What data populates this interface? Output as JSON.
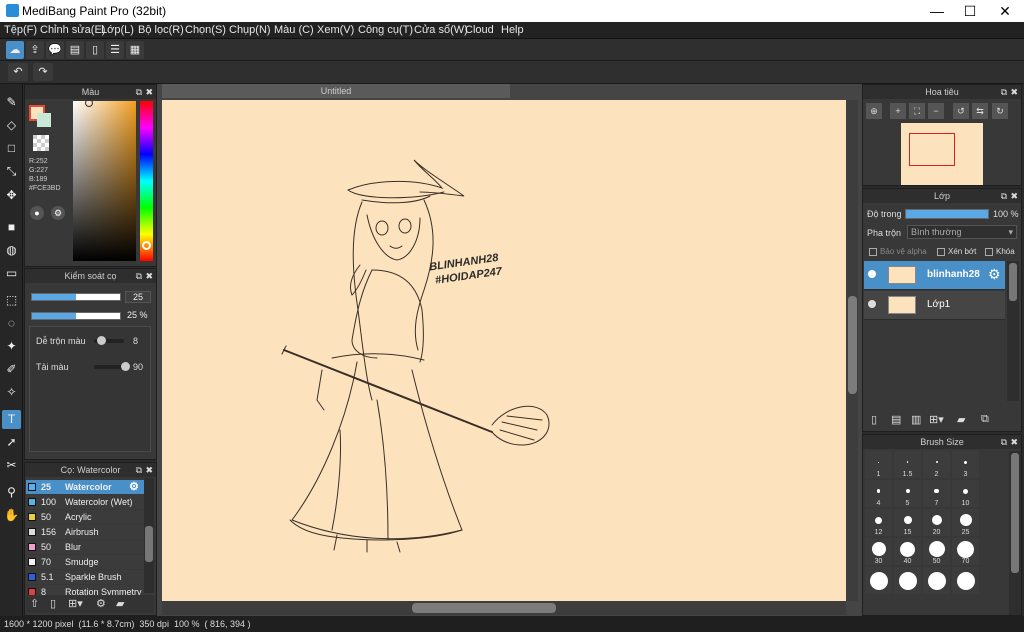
{
  "window": {
    "title": "MediBang Paint Pro (32bit)",
    "minimize": "—",
    "maximize": "☐",
    "close": "✕"
  },
  "menu": [
    "Tệp(F)",
    "Chỉnh sửa(E)",
    "Lớp(L)",
    "Bộ lọc(R)",
    "Chọn(S)",
    "Chụp(N)",
    "Màu (C)",
    "Xem(V)",
    "Công cụ(T)",
    "Cửa sổ(W)",
    "Cloud",
    "Help"
  ],
  "canvas": {
    "tab": "Untitled",
    "paper_color": "#FCE3BD",
    "watermark_line1": "BLINHANH28",
    "watermark_line2": "#HOIDAP247"
  },
  "color_panel": {
    "title": "Màu",
    "r": "R:252",
    "g": "G:227",
    "b": "B:189",
    "hex": "#FCE3BD"
  },
  "brush_control": {
    "title": "Kiểm soát cọ",
    "size_value": "25",
    "opacity_value": "25 %",
    "opacity_fraction": 0.5,
    "size_fraction": 0.5,
    "blend_label": "Dễ trộn màu",
    "blend_value": "8",
    "blend_fraction": 0.1,
    "reload_label": "Tải màu",
    "reload_value": "90",
    "reload_fraction": 0.9
  },
  "brush_list": {
    "title": "Cọ: Watercolor",
    "items": [
      {
        "size": "25",
        "name": "Watercolor",
        "color": "#5ab0e8"
      },
      {
        "size": "100",
        "name": "Watercolor (Wet)",
        "color": "#5ab0e8"
      },
      {
        "size": "50",
        "name": "Acrylic",
        "color": "#e8d040"
      },
      {
        "size": "156",
        "name": "Airbrush",
        "color": "#dddddd"
      },
      {
        "size": "50",
        "name": "Blur",
        "color": "#f0a0c8"
      },
      {
        "size": "70",
        "name": "Smudge",
        "color": "#f4f4f4"
      },
      {
        "size": "5.1",
        "name": "Sparkle Brush",
        "color": "#3060e0"
      },
      {
        "size": "8",
        "name": "Rotation Symmetry",
        "color": "#e04040"
      }
    ]
  },
  "navigator": {
    "title": "Hoa tiêu"
  },
  "layers": {
    "title": "Lớp",
    "opacity_label": "Độ trong",
    "opacity_value": "100 %",
    "opacity_fraction": 1.0,
    "blend_label": "Pha trộn",
    "blend_value": "Bình thường",
    "protect_alpha": "Bảo vệ alpha",
    "clipping": "Xén bớt",
    "lock": "Khóa",
    "items": [
      {
        "name": "blinhanh28"
      },
      {
        "name": "Lớp1"
      }
    ]
  },
  "brush_size": {
    "title": "Brush Size",
    "labels": [
      "1",
      "1.5",
      "2",
      "3",
      "4",
      "5",
      "7",
      "10",
      "12",
      "15",
      "20",
      "25",
      "30",
      "40",
      "50",
      "70",
      "",
      "",
      "",
      ""
    ]
  },
  "status": "1600 * 1200 pixel  (11.6 * 8.7cm)  350 dpi  100 %  ( 816, 394 )"
}
